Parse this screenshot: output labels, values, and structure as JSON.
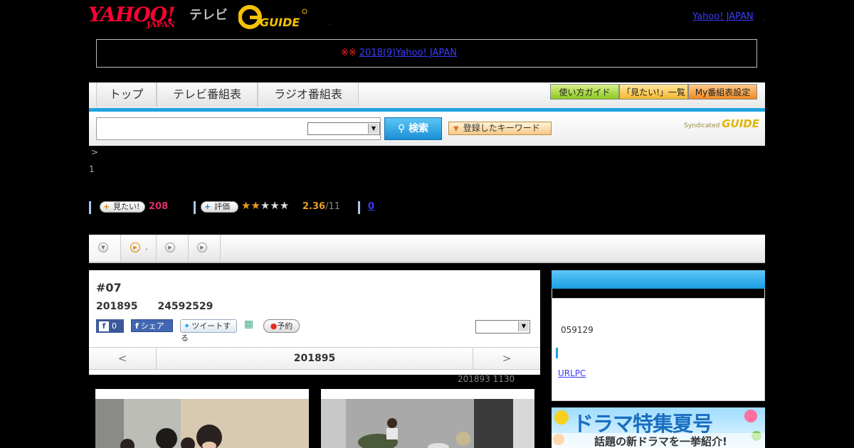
{
  "header": {
    "logo_yahoo": "YAHOO!",
    "logo_japan": "JAPAN",
    "logo_tv": "テレビ",
    "logo_gguide": "GUIDE",
    "yahoo_japan_link": "Yahoo! JAPAN",
    "dot1": ".",
    "dot2": "."
  },
  "notice": {
    "marks": "※※",
    "link": "2018(9)Yahoo! JAPAN"
  },
  "nav": {
    "tabs": [
      "トップ",
      "テレビ番組表",
      "ラジオ番組表"
    ],
    "buttons": [
      "使い方ガイド",
      "「見たい!」一覧",
      "My番組表設定"
    ]
  },
  "search": {
    "button": "検索",
    "keyword_button": "登録したキーワード",
    "syndicated": "Syndicated",
    "syndicated_brand": "GUIDE"
  },
  "breadcrumb": {
    "arrow": ">",
    "line2": "1"
  },
  "stats": {
    "want_label": "見たい!",
    "want_count": "208",
    "rate_label": "評価",
    "stars_filled": 2,
    "stars_total": 5,
    "rating": "2.36",
    "rating_count": "/11",
    "comments": "0"
  },
  "tabs_row": {
    "tab2_text": "."
  },
  "episode": {
    "title": "#07",
    "date_line": "201895　　24592529",
    "fb_count": "0",
    "fb_share": "シェア",
    "tweet": "ツイートする",
    "reserve": "予約",
    "pager_prev": "<",
    "pager_date": "201895",
    "pager_next": ">"
  },
  "updated": "201893  1130",
  "right_panel": {
    "code": "059129",
    "link": "URLPC"
  },
  "banner": {
    "title": "ドラマ特集夏号",
    "subtitle": "話題の新ドラマを一挙紹介!"
  },
  "colors": {
    "accent_blue": "#1fa3e0",
    "red": "#ff0033",
    "star": "#e8a020"
  }
}
